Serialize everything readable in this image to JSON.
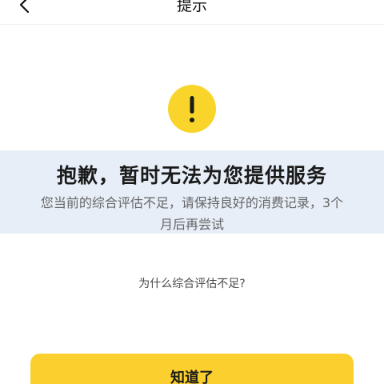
{
  "nav": {
    "title": "提示"
  },
  "notice": {
    "heading": "抱歉，暂时无法为您提供服务",
    "description": "您当前的综合评估不足，请保持良好的消费记录，3个月后再尝试"
  },
  "links": {
    "why": "为什么综合评估不足?"
  },
  "actions": {
    "confirm_label": "知道了"
  },
  "colors": {
    "accent": "#f9d42b",
    "band": "#e7eef8"
  },
  "icons": {
    "back": "chevron-left-icon",
    "alert": "exclamation-icon"
  }
}
